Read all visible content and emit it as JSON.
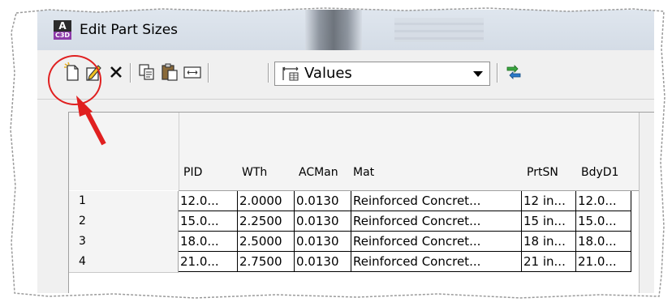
{
  "window": {
    "title": "Edit Part Sizes",
    "app_icon_letter": "A",
    "app_icon_sub": "C3D"
  },
  "toolbar": {
    "buttons": [
      "new-part-icon",
      "edit-icon",
      "delete-icon",
      "copy-icon",
      "paste-icon",
      "resize-columns-icon",
      "refresh-icon"
    ],
    "view_dropdown": {
      "selected": "Values"
    }
  },
  "grid": {
    "columns": [
      "PID",
      "WTh",
      "ACMan",
      "Mat",
      "PrtSN",
      "BdyD1"
    ],
    "rows": [
      {
        "num": "1",
        "cells": [
          "12.0...",
          "2.0000",
          "0.0130",
          "Reinforced Concret...",
          "12 in...",
          "12.0..."
        ]
      },
      {
        "num": "2",
        "cells": [
          "15.0...",
          "2.2500",
          "0.0130",
          "Reinforced Concret...",
          "15 in...",
          "15.0..."
        ]
      },
      {
        "num": "3",
        "cells": [
          "18.0...",
          "2.5000",
          "0.0130",
          "Reinforced Concret...",
          "18 in...",
          "18.0..."
        ]
      },
      {
        "num": "4",
        "cells": [
          "21.0...",
          "2.7500",
          "0.0130",
          "Reinforced Concret...",
          "21 in...",
          "21.0..."
        ]
      }
    ]
  },
  "annotation": {
    "color": "#e02020"
  }
}
